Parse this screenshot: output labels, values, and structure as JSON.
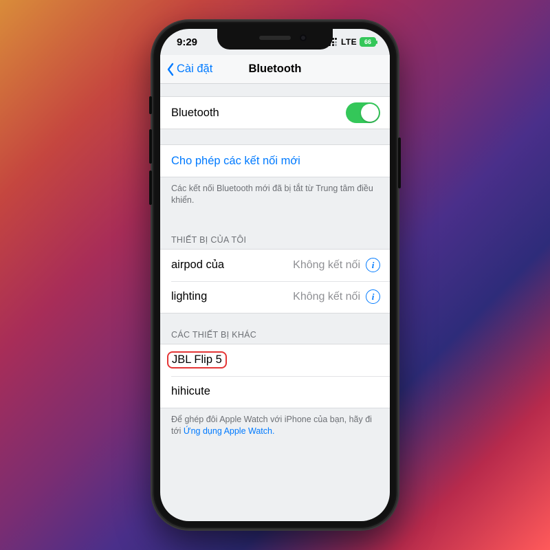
{
  "status": {
    "time": "9:29",
    "carrier_label": "LTE",
    "battery_text": "66"
  },
  "nav": {
    "back_label": "Cài đặt",
    "title": "Bluetooth"
  },
  "bluetooth_toggle": {
    "label": "Bluetooth",
    "on": true
  },
  "allow_new": {
    "label": "Cho phép các kết nối mới",
    "note": "Các kết nối Bluetooth mới đã bị tắt từ Trung tâm điều khiển."
  },
  "my_devices": {
    "header": "THIẾT BỊ CỦA TÔI",
    "items": [
      {
        "name": "airpod của",
        "status": "Không kết nối"
      },
      {
        "name": "lighting",
        "status": "Không kết nối"
      }
    ]
  },
  "other_devices": {
    "header": "CÁC THIẾT BỊ KHÁC",
    "items": [
      {
        "name": "JBL Flip 5",
        "highlighted": true
      },
      {
        "name": "hihicute",
        "highlighted": false
      }
    ]
  },
  "watch_note": {
    "prefix": "Để ghép đôi Apple Watch với iPhone của bạn, hãy đi tới ",
    "link": "Ứng dụng Apple Watch.",
    "suffix": ""
  },
  "colors": {
    "ios_blue": "#007aff",
    "ios_green": "#34c759",
    "highlight_red": "#e43535"
  }
}
